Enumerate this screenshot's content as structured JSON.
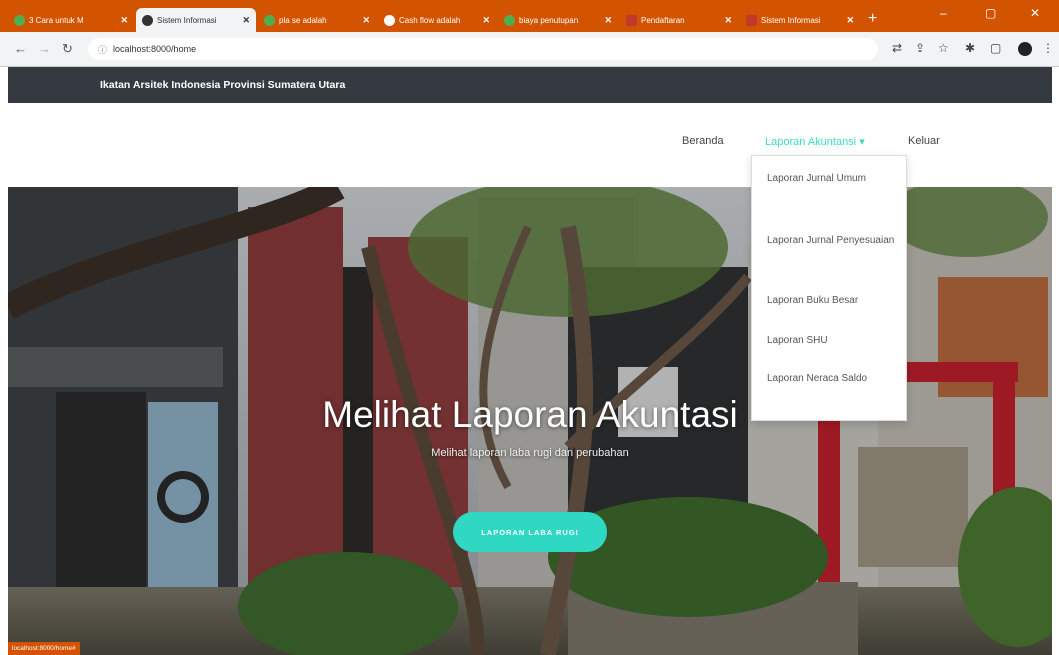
{
  "browser": {
    "tabs": [
      {
        "label": "3 Cara untuk M",
        "color": "#4caf50"
      },
      {
        "label": "Sistem Informasi",
        "color": "#333333",
        "active": true
      },
      {
        "label": "pla se adalah",
        "color": "#4caf50"
      },
      {
        "label": "Cash flow adalah",
        "color": "#ffffff"
      },
      {
        "label": "biaya penutupan",
        "color": "#4caf50"
      },
      {
        "label": "Pendaftaran",
        "color": "#c0392b"
      },
      {
        "label": "Sistem Informasi",
        "color": "#c0392b"
      }
    ],
    "tab_close": "✕",
    "new_tab": "+",
    "window": {
      "minimize": "–",
      "restore": "▢",
      "close": "✕"
    },
    "url": "localhost:8000/home",
    "icons": {
      "back": "arrow-left",
      "forward": "arrow-right",
      "reload": "reload",
      "info": "info"
    }
  },
  "site": {
    "brand": "Ikatan Arsitek Indonesia Provinsi Sumatera Utara",
    "nav": {
      "home": "Beranda",
      "reports": "Laporan Akuntansi",
      "caret": "▾",
      "logout": "Keluar"
    },
    "dropdown": {
      "items": [
        "Laporan Jurnal Umum",
        "Laporan Jurnal Penyesuaian",
        "Laporan Buku Besar",
        "Laporan SHU",
        "Laporan Neraca Saldo"
      ]
    },
    "hero": {
      "title": "Melihat Laporan Akuntasi",
      "subtitle": "Melihat laporan laba rugi dan perubahan",
      "button": "LAPORAN LABA RUGI"
    },
    "status_url": "localhost:8000/home#"
  },
  "colors": {
    "browser_chrome": "#d35400",
    "site_header": "#343a40",
    "accent": "#2fd8c3"
  }
}
